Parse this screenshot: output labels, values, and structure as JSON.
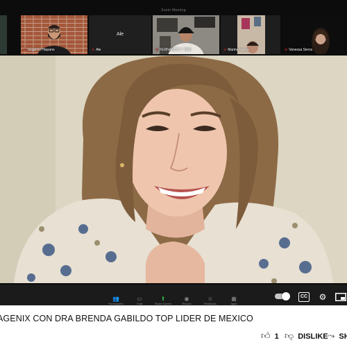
{
  "zoom": {
    "window_title": "Zoom Meeting",
    "participants": [
      {
        "name": "Isagenix Hispano"
      },
      {
        "name": "Ale"
      },
      {
        "name": "FERNANDO Y YENI"
      },
      {
        "name": "Marina Garza"
      },
      {
        "name": "Vanessa Sierra"
      }
    ],
    "avatar_tile_label": "Ale",
    "toolbar": [
      {
        "label": "Participants",
        "icon": "people-icon"
      },
      {
        "label": "Chat",
        "icon": "chat-icon"
      },
      {
        "label": "Share Screen",
        "icon": "share-screen-icon"
      },
      {
        "label": "Record",
        "icon": "record-icon"
      },
      {
        "label": "Reactions",
        "icon": "reactions-icon"
      },
      {
        "label": "Apps",
        "icon": "apps-icon"
      }
    ]
  },
  "player": {
    "progress": 0,
    "controls": [
      "autoplay-toggle",
      "cc-button",
      "settings-icon",
      "miniplayer-icon"
    ],
    "cc_label": "CC",
    "colors": {
      "progress": "#ff0000",
      "bar_bg": "#1b1b1b"
    }
  },
  "video": {
    "title": "AGENIX CON DRA BRENDA GABILDO TOP LIDER DE MEXICO"
  },
  "actions": {
    "like_count": "1",
    "dislike_label": "DISLIKE",
    "share_label": "SH"
  }
}
